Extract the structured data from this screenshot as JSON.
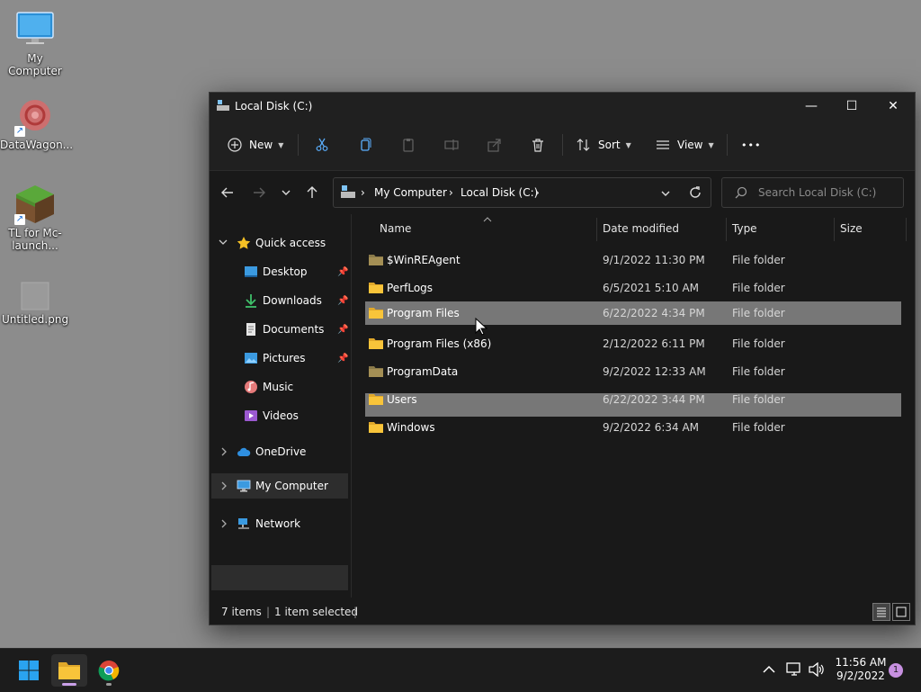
{
  "desktop": {
    "icons": [
      {
        "label": "My Computer"
      },
      {
        "label": "DataWagon..."
      },
      {
        "label": "TL for Mc-launch..."
      },
      {
        "label": "Untitled.png"
      }
    ]
  },
  "window": {
    "title": "Local Disk (C:)",
    "controls": {
      "minimize": "—",
      "maximize": "☐",
      "close": "✕"
    },
    "toolbar": {
      "new_label": "New",
      "sort_label": "Sort",
      "view_label": "View",
      "more_label": "•••"
    },
    "address": {
      "segments": [
        "My Computer",
        "Local Disk (C:)"
      ],
      "separator": "›"
    },
    "search": {
      "placeholder": "Search Local Disk (C:)"
    },
    "sidebar": {
      "quick_access": "Quick access",
      "items": [
        {
          "label": "Desktop",
          "pinned": true
        },
        {
          "label": "Downloads",
          "pinned": true
        },
        {
          "label": "Documents",
          "pinned": true
        },
        {
          "label": "Pictures",
          "pinned": true
        },
        {
          "label": "Music",
          "pinned": false
        },
        {
          "label": "Videos",
          "pinned": false
        }
      ],
      "onedrive": "OneDrive",
      "my_computer": "My Computer",
      "network": "Network"
    },
    "columns": {
      "name": "Name",
      "date": "Date modified",
      "type": "Type",
      "size": "Size"
    },
    "files": [
      {
        "name": "$WinREAgent",
        "date": "9/1/2022 11:30 PM",
        "type": "File folder"
      },
      {
        "name": "PerfLogs",
        "date": "6/5/2021 5:10 AM",
        "type": "File folder"
      },
      {
        "name": "Program Files",
        "date": "6/22/2022 4:34 PM",
        "type": "File folder",
        "selected": true
      },
      {
        "name": "Program Files (x86)",
        "date": "2/12/2022 6:11 PM",
        "type": "File folder"
      },
      {
        "name": "ProgramData",
        "date": "9/2/2022 12:33 AM",
        "type": "File folder"
      },
      {
        "name": "Users",
        "date": "6/22/2022 3:44 PM",
        "type": "File folder"
      },
      {
        "name": "Windows",
        "date": "9/2/2022 6:34 AM",
        "type": "File folder"
      }
    ],
    "status": {
      "count": "7 items",
      "selection": "1 item selected"
    }
  },
  "taskbar": {
    "time": "11:56 AM",
    "date": "9/2/2022",
    "notifications": "1"
  },
  "colors": {
    "accent": "#0067c0",
    "folder": "#f8c43a",
    "selected_row": "#777777"
  }
}
